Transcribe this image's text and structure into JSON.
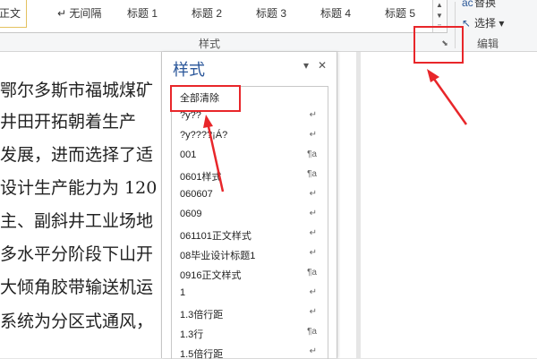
{
  "ribbon": {
    "style_gallery": [
      {
        "label": "正文"
      },
      {
        "label": "↵ 无间隔"
      },
      {
        "label": "标题 1"
      },
      {
        "label": "标题 2"
      },
      {
        "label": "标题 3"
      },
      {
        "label": "标题 4"
      },
      {
        "label": "标题 5"
      }
    ],
    "group_label": "样式",
    "launcher_icon": "dialog-launcher-icon",
    "edit_group": {
      "replace_label": "替换",
      "select_label": "选择 ▾",
      "group_label": "编辑"
    }
  },
  "document": {
    "lines": [
      "鄂尔多斯市福城煤矿",
      "  井田开拓朝着生产",
      "发展，进而选择了适",
      "设计生产能力为 120",
      "主、副斜井工业场地",
      "多水平分阶段下山开",
      "大倾角胶带输送机运",
      "系统为分区式通风，"
    ]
  },
  "styles_pane": {
    "title": "样式",
    "dropdown_icon": "▾",
    "close_icon": "✕",
    "items": [
      {
        "name": "全部清除",
        "marker": ""
      },
      {
        "name": "?y??",
        "marker": "↵"
      },
      {
        "name": "?y????¡Á?",
        "marker": "↵"
      },
      {
        "name": "001",
        "marker": "¶a"
      },
      {
        "name": "0601样式",
        "marker": "¶a"
      },
      {
        "name": "060607",
        "marker": "↵"
      },
      {
        "name": "0609",
        "marker": "↵"
      },
      {
        "name": "061101正文样式",
        "marker": "↵"
      },
      {
        "name": "08毕业设计标题1",
        "marker": "↵"
      },
      {
        "name": "0916正文样式",
        "marker": "¶a"
      },
      {
        "name": "1",
        "marker": "↵"
      },
      {
        "name": "1.3倍行距",
        "marker": "↵"
      },
      {
        "name": "1.3行",
        "marker": "¶a"
      },
      {
        "name": "1.5倍行距",
        "marker": "↵"
      }
    ]
  },
  "colors": {
    "accent": "#2b579a",
    "annotation": "#e8262a"
  }
}
